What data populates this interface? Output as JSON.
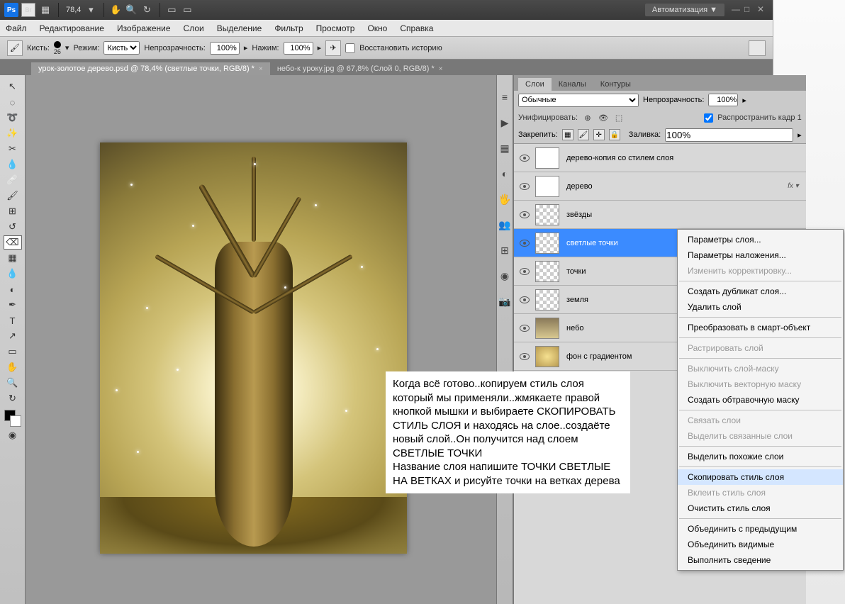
{
  "titlebar": {
    "ps": "Ps",
    "br": "Br",
    "zoom": "78,4",
    "automation": "Автоматизация ▼"
  },
  "menu": {
    "file": "Файл",
    "edit": "Редактирование",
    "image": "Изображение",
    "layers": "Слои",
    "select": "Выделение",
    "filter": "Фильтр",
    "view": "Просмотр",
    "window": "Окно",
    "help": "Справка"
  },
  "options": {
    "brush_label": "Кисть:",
    "brush_size": "26",
    "mode_label": "Режим:",
    "mode_value": "Кисть",
    "opacity_label": "Непрозрачность:",
    "opacity_value": "100%",
    "flow_label": "Нажим:",
    "flow_value": "100%",
    "restore": "Восстановить историю"
  },
  "tabs": {
    "tab1": "урок-золотое дерево.psd @ 78,4% (светлые точки, RGB/8) *",
    "tab2": "небо-к уроку.jpg @ 67,8% (Слой 0, RGB/8) *"
  },
  "panel": {
    "tab_layers": "Слои",
    "tab_channels": "Каналы",
    "tab_paths": "Контуры",
    "blend_mode": "Обычные",
    "opacity_label": "Непрозрачность:",
    "opacity_value": "100%",
    "unify_label": "Унифицировать:",
    "propagate": "Распространить кадр 1",
    "lock_label": "Закрепить:",
    "fill_label": "Заливка:",
    "fill_value": "100%"
  },
  "layers": {
    "l0": "дерево-копия со стилем слоя",
    "l1": "дерево",
    "l1_fx": "fx ▾",
    "l2": "звёзды",
    "l3": "светлые точки",
    "l4": "точки",
    "l5": "земля",
    "l6": "небо",
    "l7": "фон с градиентом"
  },
  "ctx": {
    "i0": "Параметры слоя...",
    "i1": "Параметры наложения...",
    "i2": "Изменить корректировку...",
    "i3": "Создать дубликат слоя...",
    "i4": "Удалить слой",
    "i5": "Преобразовать в смарт-объект",
    "i6": "Растрировать слой",
    "i7": "Выключить слой-маску",
    "i8": "Выключить векторную маску",
    "i9": "Создать обтравочную маску",
    "i10": "Связать слои",
    "i11": "Выделить связанные слои",
    "i12": "Выделить похожие слои",
    "i13": "Скопировать стиль слоя",
    "i14": "Вклеить стиль слоя",
    "i15": "Очистить стиль слоя",
    "i16": "Объединить с предыдущим",
    "i17": "Объединить видимые",
    "i18": "Выполнить сведение"
  },
  "note": "Когда всё готово..копируем стиль слоя который мы применяли..жмякаете правой кнопкой мышки и выбираете СКОПИРОВАТЬ СТИЛЬ СЛОЯ и находясь на слое..создаёте новый слой..Он получится над слоем СВЕТЛЫЕ ТОЧКИ\nНазвание слоя напишите ТОЧКИ СВЕТЛЫЕ НА ВЕТКАХ и рисуйте точки на ветках дерева"
}
